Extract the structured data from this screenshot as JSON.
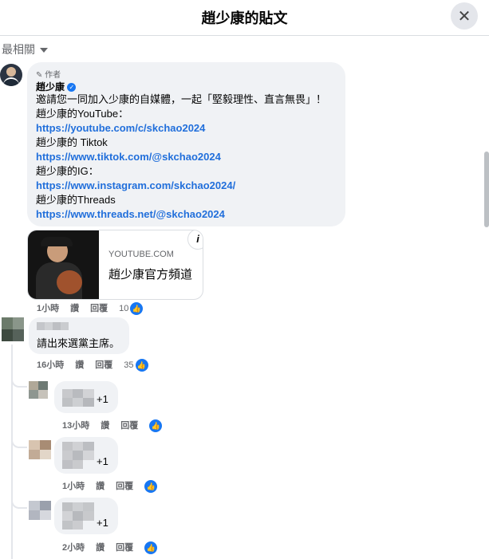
{
  "header": {
    "title": "趙少康的貼文",
    "close_icon": "close-icon"
  },
  "sort": {
    "label": "最相關"
  },
  "post_comment": {
    "author_badge": "作者",
    "author_name": "趙少康",
    "lines": [
      "邀請您一同加入少康的自媒體，一起「堅毅理性、直言無畏」！",
      "趙少康的YouTube：",
      "https://youtube.com/c/skchao2024",
      "趙少康的 Tiktok",
      "https://www.tiktok.com/@skchao2024",
      "趙少康的IG：",
      "https://www.instagram.com/skchao2024/",
      "趙少康的Threads",
      "https://www.threads.net/@skchao2024"
    ],
    "preview": {
      "domain": "YOUTUBE.COM",
      "title": "趙少康官方頻道"
    },
    "time": "1小時",
    "like": "讚",
    "reply": "回覆",
    "likes": "10"
  },
  "reply1": {
    "text": "請出來選黨主席。",
    "time": "16小時",
    "like": "讚",
    "reply": "回覆",
    "likes": "35"
  },
  "reply2": {
    "badge": "+1",
    "time": "13小時",
    "like": "讚",
    "reply": "回覆"
  },
  "reply3": {
    "badge": "+1",
    "time": "1小時",
    "like": "讚",
    "reply": "回覆"
  },
  "reply4": {
    "badge": "+1",
    "time": "2小時",
    "like": "讚",
    "reply": "回覆"
  },
  "colors": {
    "link": "#216fdb",
    "like": "#1877f2",
    "bubble": "#f0f2f5"
  }
}
